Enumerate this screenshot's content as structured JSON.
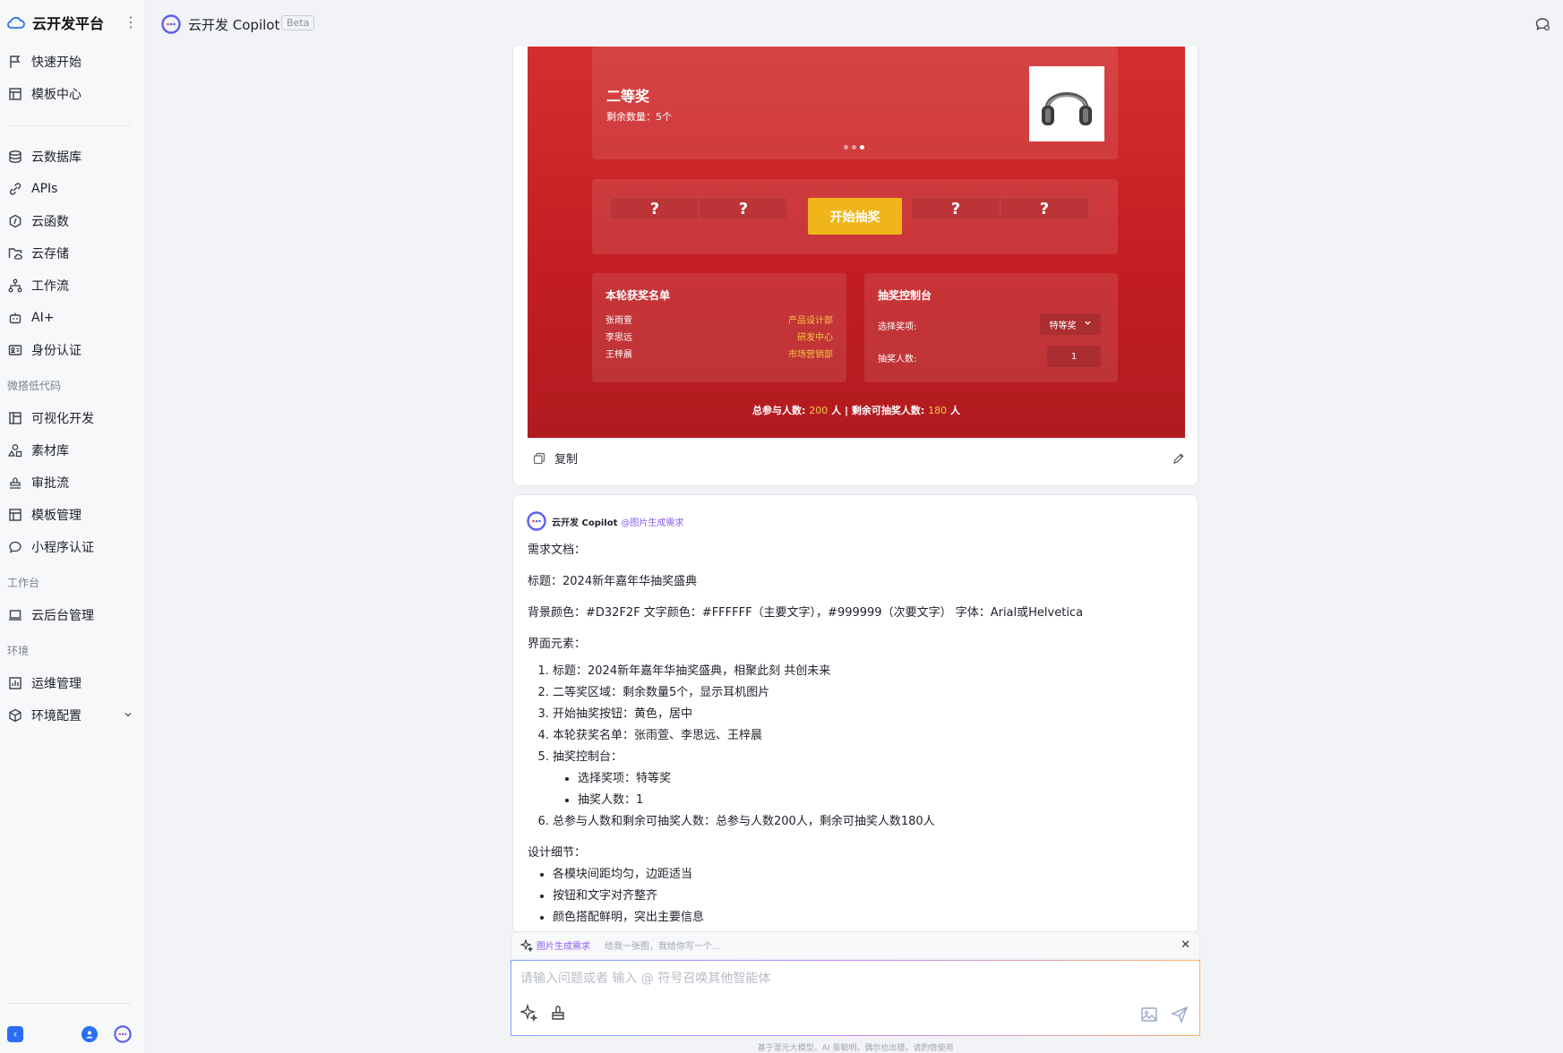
{
  "sidebar": {
    "brand": "云开发平台",
    "more_glyph": "⋮",
    "items_top": [
      {
        "label": "快速开始",
        "icon": "flag-icon"
      },
      {
        "label": "模板中心",
        "icon": "template-icon"
      }
    ],
    "items_main": [
      {
        "label": "云数据库",
        "icon": "database-icon"
      },
      {
        "label": "APIs",
        "icon": "link-icon"
      },
      {
        "label": "云函数",
        "icon": "function-icon"
      },
      {
        "label": "云存储",
        "icon": "folder-cloud-icon"
      },
      {
        "label": "工作流",
        "icon": "workflow-icon"
      },
      {
        "label": "AI+",
        "icon": "robot-icon"
      },
      {
        "label": "身份认证",
        "icon": "id-card-icon"
      }
    ],
    "section_lowcode": "微搭低代码",
    "items_lowcode": [
      {
        "label": "可视化开发",
        "icon": "layout-icon"
      },
      {
        "label": "素材库",
        "icon": "shapes-icon"
      },
      {
        "label": "审批流",
        "icon": "stamp-icon"
      },
      {
        "label": "模板管理",
        "icon": "template-manage-icon"
      },
      {
        "label": "小程序认证",
        "icon": "chat-bubble-icon"
      }
    ],
    "section_workbench": "工作台",
    "items_workbench": [
      {
        "label": "云后台管理",
        "icon": "laptop-icon"
      }
    ],
    "section_env": "环境",
    "items_env": [
      {
        "label": "运维管理",
        "icon": "chart-icon"
      },
      {
        "label": "环境配置",
        "icon": "cube-icon"
      }
    ]
  },
  "header": {
    "title": "云开发 Copilot",
    "badge": "Beta"
  },
  "preview": {
    "prize_name": "二等奖",
    "prize_remaining": "剩余数量：5个",
    "question_mark": "?",
    "start_button": "开始抽奖",
    "winners_title": "本轮获奖名单",
    "winners": [
      {
        "name": "张雨萱",
        "dept": "产品设计部"
      },
      {
        "name": "李思远",
        "dept": "研发中心"
      },
      {
        "name": "王梓晨",
        "dept": "市场营销部"
      }
    ],
    "console_title": "抽奖控制台",
    "select_label": "选择奖项:",
    "select_value": "特等奖",
    "count_label": "抽奖人数:",
    "count_value": "1",
    "totals_prefix": "总参与人数:",
    "totals_total": "200",
    "totals_unit1": "人 |",
    "totals_mid": "剩余可抽奖人数:",
    "totals_remaining": "180",
    "totals_unit2": "人",
    "carousel": {
      "slides": 3,
      "active_slide": 3
    }
  },
  "card1_actions": {
    "copy_label": "复制"
  },
  "message": {
    "sender": "云开发 Copilot",
    "tag": "@图片生成需求",
    "p1": "需求文档：",
    "p2": "标题：2024新年嘉年华抽奖盛典",
    "p3": "背景颜色：#D32F2F 文字颜色：#FFFFFF（主要文字），#999999（次要文字） 字体：Arial或Helvetica",
    "p4": "界面元素：",
    "list": [
      "标题：2024新年嘉年华抽奖盛典，相聚此刻 共创未来",
      "二等奖区域：剩余数量5个，显示耳机图片",
      "开始抽奖按钮：黄色，居中",
      "本轮获奖名单：张雨萱、李思远、王梓晨",
      "抽奖控制台："
    ],
    "sublist": [
      "选择奖项：特等奖",
      "抽奖人数：1"
    ],
    "list6": "总参与人数和剩余可抽奖人数：总参与人数200人，剩余可抽奖人数180人",
    "p5": "设计细节：",
    "details": [
      "各模块间距均匀，边距适当",
      "按钮和文字对齐整齐",
      "颜色搭配鲜明，突出主要信息"
    ]
  },
  "composer": {
    "skill": "图片生成需求",
    "skill_hint": "给我一张图，我给你写一个...",
    "placeholder": "请输入问题或者 输入 @ 符号召唤其他智能体",
    "footnote": "基于混元大模型，AI 虽聪明，偶尔也出错，请酌情使用",
    "close_glyph": "✕"
  },
  "colors": {
    "accent": "#2b6ef6",
    "lottery_bg": "#D32F2F",
    "start_button": "#f0b518",
    "highlight": "#f5c542",
    "skill": "#8a5cf6"
  }
}
